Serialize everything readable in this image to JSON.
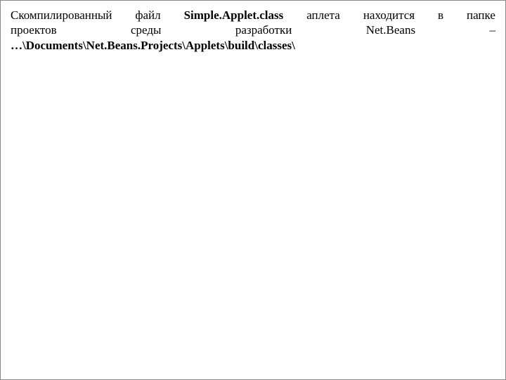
{
  "paragraph": {
    "line1": {
      "w1": "Скомпилированный",
      "w2": "файл",
      "w3_bold": "Simple.Applet.class",
      "w4": "аплета",
      "w5": "находится",
      "w6": "в",
      "w7": "папке"
    },
    "line2": {
      "w1": "проектов",
      "w2": "среды",
      "w3": "разработки",
      "w4": "Net.Beans",
      "w5": "–"
    },
    "line3_bold": "…\\Documents\\Net.Beans.Projects\\Applets\\build\\classes\\"
  }
}
